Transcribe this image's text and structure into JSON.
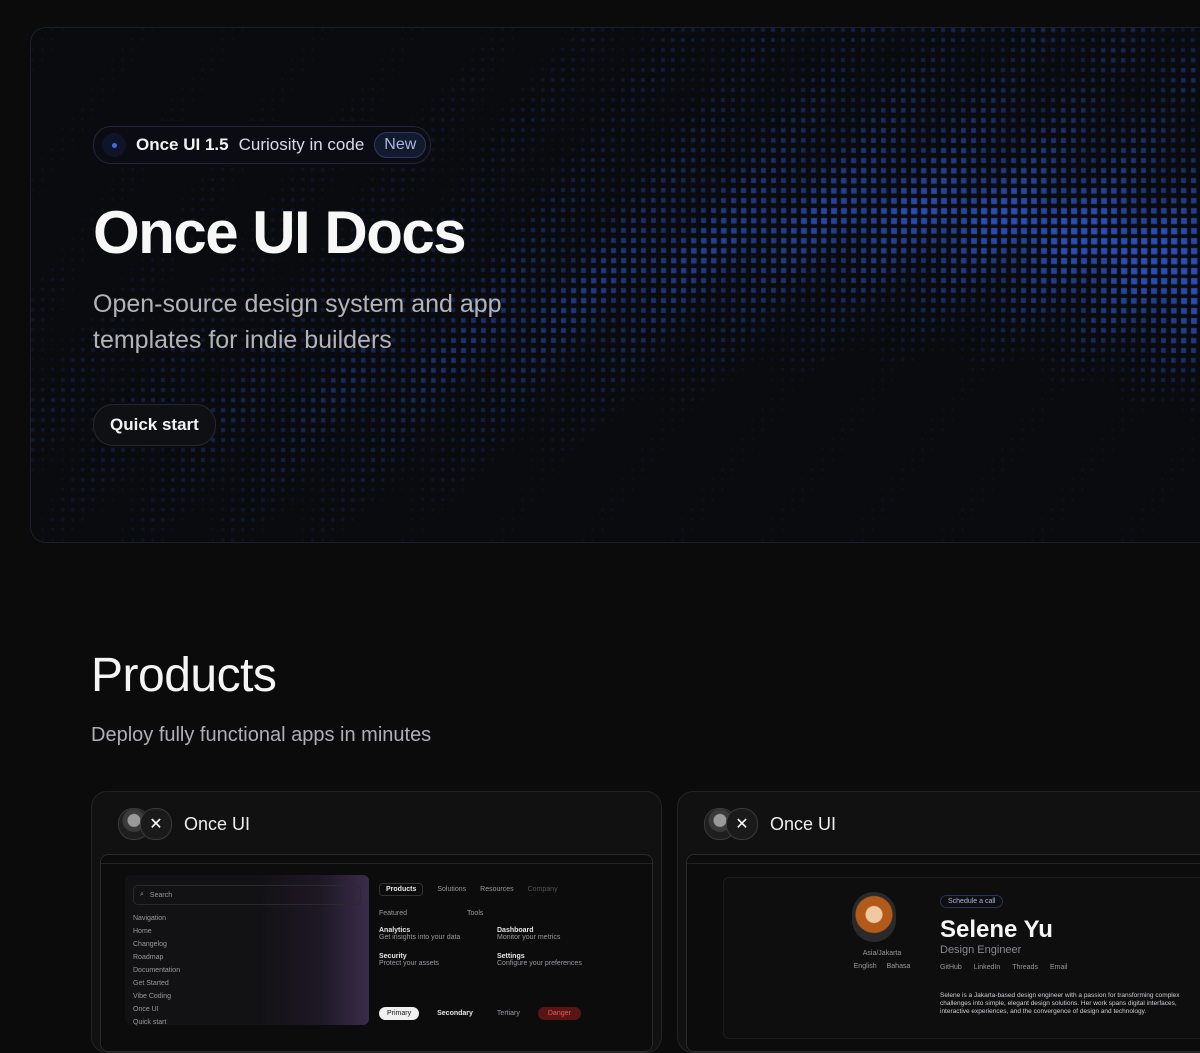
{
  "hero": {
    "badge": {
      "version": "Once UI 1.5",
      "tagline": "Curiosity in code",
      "new_label": "New"
    },
    "title": "Once UI Docs",
    "subtitle": "Open-source design system and app templates for indie builders",
    "cta_label": "Quick start"
  },
  "products": {
    "title": "Products",
    "subtitle": "Deploy fully functional apps in minutes",
    "cards": [
      {
        "name": "Once UI",
        "preview": {
          "search_placeholder": "Search",
          "nav_section": "Navigation",
          "nav_items": [
            "Home",
            "Changelog",
            "Roadmap"
          ],
          "docs_section": "Documentation",
          "docs_items": [
            "Get Started",
            "Vibe Coding"
          ],
          "once_section": "Once UI",
          "once_items": [
            "Quick start"
          ],
          "menu_tabs": [
            "Products",
            "Solutions",
            "Resources",
            "Company"
          ],
          "featured_label": "Featured",
          "tools_label": "Tools",
          "menu_items": [
            {
              "title": "Analytics",
              "desc": "Get insights into your data"
            },
            {
              "title": "Dashboard",
              "desc": "Monitor your metrics"
            },
            {
              "title": "Security",
              "desc": "Protect your assets"
            },
            {
              "title": "Settings",
              "desc": "Configure your preferences"
            }
          ],
          "buttons": [
            "Primary",
            "Secondary",
            "Tertiary",
            "Danger"
          ]
        }
      },
      {
        "name": "Once UI",
        "preview": {
          "schedule_label": "Schedule a call",
          "person_name": "Selene Yu",
          "person_role": "Design Engineer",
          "location": "Asia/Jakarta",
          "languages": [
            "English",
            "Bahasa"
          ],
          "links": [
            "GitHub",
            "LinkedIn",
            "Threads",
            "Email"
          ],
          "bio": "Selene is a Jakarta-based design engineer with a passion for transforming complex challenges into simple, elegant design solutions. Her work spans digital interfaces, interactive experiences, and the convergence of design and technology."
        }
      }
    ]
  },
  "colors": {
    "accent": "#3c6cf0",
    "background": "#0b0b0c",
    "danger": "#c0392b"
  },
  "icons": [
    "dot-icon",
    "chevron-down-icon",
    "search-icon",
    "home-icon",
    "calendar-icon",
    "check-icon",
    "plus-icon",
    "gauge-icon",
    "shield-icon",
    "doc-icon",
    "globe-icon"
  ]
}
